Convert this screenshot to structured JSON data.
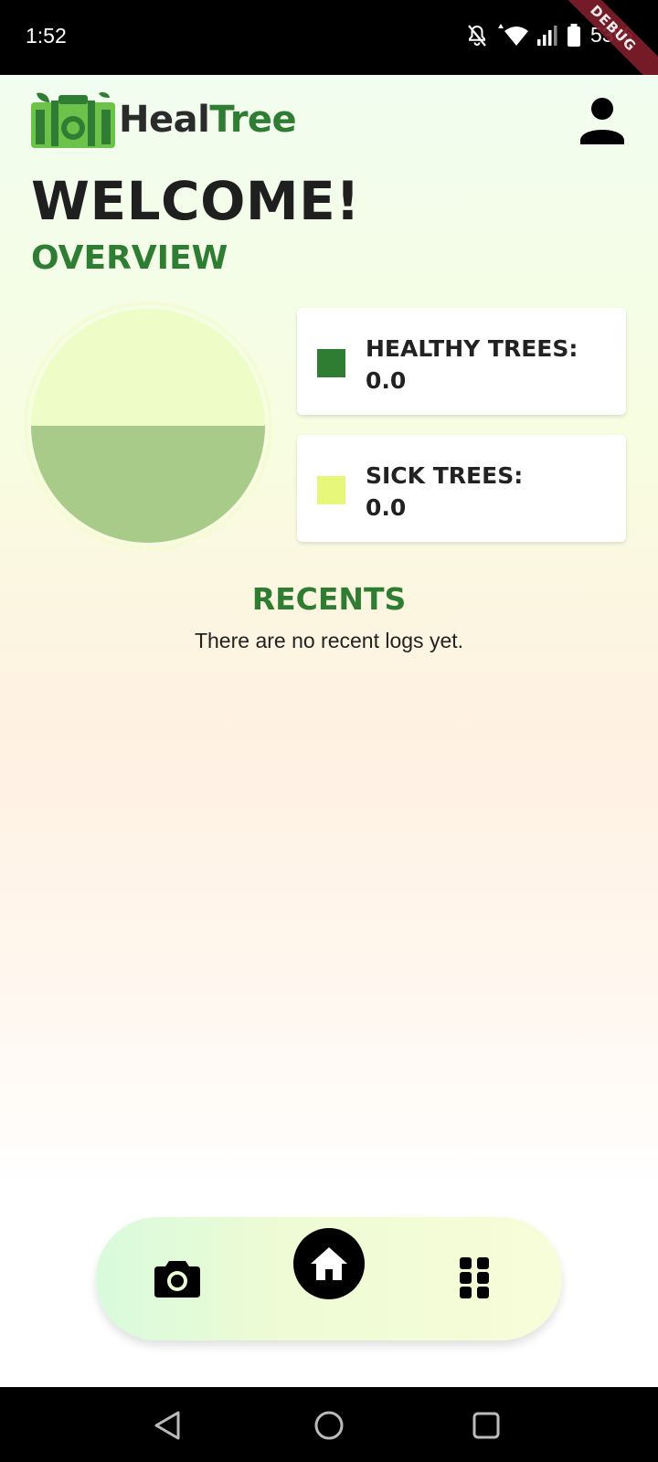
{
  "status_bar": {
    "time": "1:52",
    "battery": "53%",
    "debug_banner": "DEBUG"
  },
  "header": {
    "logo_text_part1": "Heal",
    "logo_text_part2": "Tree",
    "logo_icon": "healtree-logo-icon",
    "profile_icon": "person-icon"
  },
  "main": {
    "welcome": "WELCOME!",
    "overview_title": "OVERVIEW",
    "stats": {
      "healthy_label": "HEALTHY TREES:",
      "healthy_value": "0.0",
      "healthy_color": "#2e7d32",
      "sick_label": "SICK TREES:",
      "sick_value": "0.0",
      "sick_color": "#e6f77a"
    },
    "pie": {
      "top_color": "#eefdc8",
      "bottom_color": "#a8cb8a",
      "ring_color": "#f5fbd5"
    },
    "recents_title": "RECENTS",
    "no_logs": "There are no recent logs yet."
  },
  "bottom_nav": {
    "items": [
      {
        "name": "camera",
        "icon": "camera-icon"
      },
      {
        "name": "home",
        "icon": "home-icon",
        "active": true
      },
      {
        "name": "apps",
        "icon": "grid-icon"
      }
    ]
  },
  "system_nav": {
    "back": "back-icon",
    "home": "circle-home-icon",
    "recents": "square-recents-icon"
  }
}
